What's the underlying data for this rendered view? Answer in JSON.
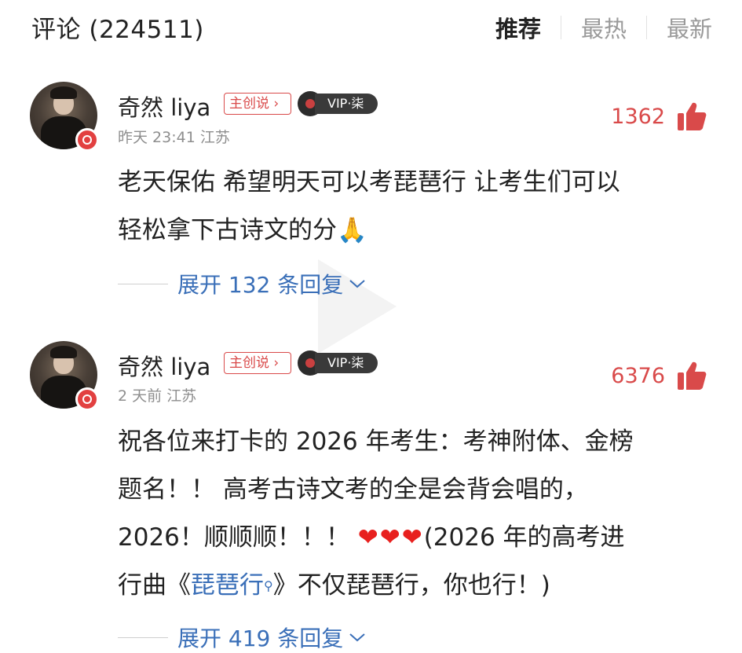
{
  "header": {
    "title": "评论 (224511)",
    "tabs": [
      {
        "label": "推荐",
        "active": true
      },
      {
        "label": "最热",
        "active": false
      },
      {
        "label": "最新",
        "active": false
      }
    ]
  },
  "comments": [
    {
      "username": "奇然 liya",
      "author_tag": "主创说",
      "vip_label": "VIP·柒",
      "time": "昨天 23:41",
      "location": "江苏",
      "likes": "1362",
      "text_line1": "老天保佑 希望明天可以考琵琶行 让考生们可以",
      "text_line2": "轻松拿下古诗文的分",
      "emoji": "🙏",
      "expand": "展开 132 条回复"
    },
    {
      "username": "奇然 liya",
      "author_tag": "主创说",
      "vip_label": "VIP·柒",
      "time": "2 天前",
      "location": "江苏",
      "likes": "6376",
      "text_line1": "祝各位来打卡的 2026 年考生：考神附体、金榜",
      "text_line2": "题名！！ 高考古诗文考的全是会背会唱的，",
      "text_line3_a": "2026！顺顺顺！！！",
      "hearts": "❤❤❤",
      "text_line3_b": "(2026 年的高考进",
      "text_line4_a": "行曲《",
      "song_link": "琵琶行",
      "text_line4_b": "》不仅琵琶行，你也行！)",
      "expand": "展开 419 条回复"
    }
  ],
  "colors": {
    "accent_red": "#d94a4a",
    "link_blue": "#3a6fb8",
    "meta_gray": "#8e8e8e"
  },
  "icons": [
    "thumb-up-icon",
    "vinyl-disc-icon",
    "chevron-down-icon",
    "search-icon",
    "netease-badge-icon"
  ]
}
